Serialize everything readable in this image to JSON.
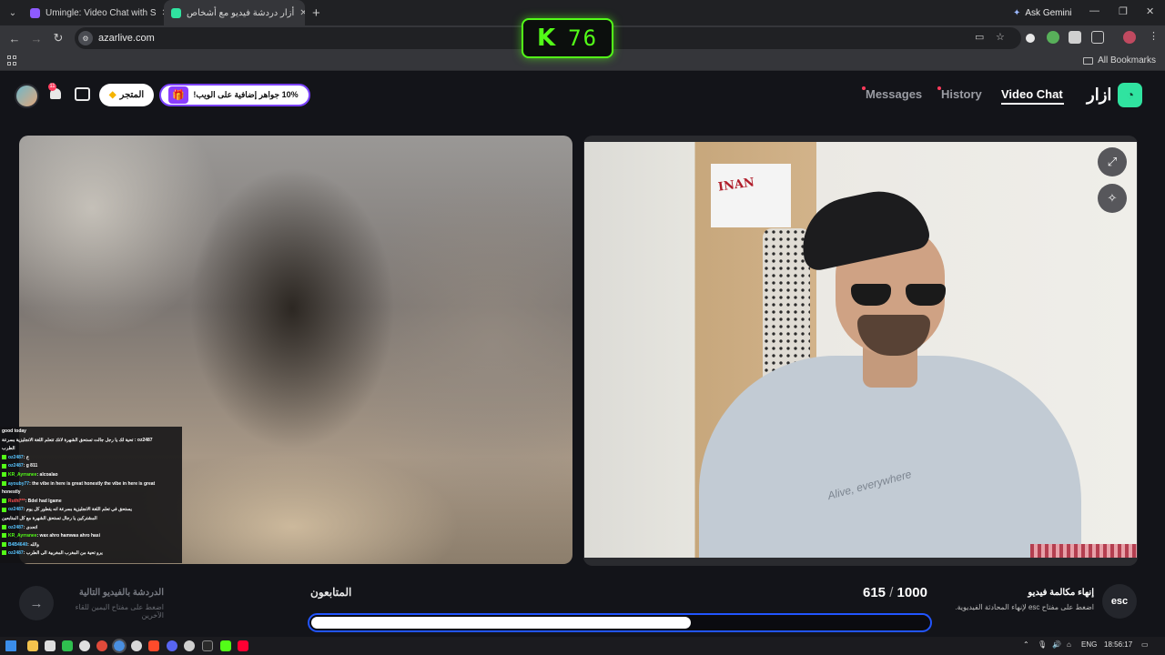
{
  "browser": {
    "tabs": [
      {
        "label": "Umingle: Video Chat with S",
        "favicon_color": "#8e5bff"
      },
      {
        "label": "أزار دردشة فيديو مع أشخاص",
        "favicon_color": "#30e3a0"
      }
    ],
    "new_tab_label": "+",
    "ask_gemini_label": "Ask Gemini",
    "url": "azarlive.com",
    "all_bookmarks_label": "All Bookmarks"
  },
  "overlay": {
    "kick_logo": "K",
    "viewer_count": "76",
    "accent": "#53fc18"
  },
  "header": {
    "store_label": "المتجر",
    "promo_label": "10% جواهر إضافية على الويب!",
    "notification_count": "11",
    "nav": {
      "messages": "Messages",
      "history": "History",
      "video_chat": "Video Chat"
    },
    "brand_word": "ازار"
  },
  "video": {
    "poster_text": "INAN",
    "shirt_text": "Alive, everywhere"
  },
  "chat": {
    "lines": [
      {
        "user": "",
        "text": "good today",
        "color": ""
      },
      {
        "user": "",
        "text": "تحية لك يا رجل جالت تستحق الشهرة لانك تتعلم اللغة الانجليزية بسرعة : oz2487",
        "color": "g"
      },
      {
        "user": "",
        "text": "الطرب",
        "color": ""
      },
      {
        "user": "oz2487",
        "text": ": خ",
        "color": "b"
      },
      {
        "user": "oz2487",
        "text": ": g 811",
        "color": "b"
      },
      {
        "user": "KR_Ayrranee",
        "text": ": alcoalao",
        "color": "g"
      },
      {
        "user": "ayouby77",
        "text": ": the vibe in here is great honestly the vibe in here is great",
        "color": "b"
      },
      {
        "user": "",
        "text": "honestly",
        "color": ""
      },
      {
        "user": "Ruthl***",
        "text": ": Bdel had lgame",
        "color": "r"
      },
      {
        "user": "oz2487",
        "text": ": يستحق في تعلم اللغة الانجليزية بسرعة انه يتطور كل يوم",
        "color": "b"
      },
      {
        "user": "",
        "text": "المشتركين يا رجال تستحق الشهرة مع كل المتابعين",
        "color": ""
      },
      {
        "user": "oz2487",
        "text": ": اتحدى",
        "color": "b"
      },
      {
        "user": "KR_Ayrranee",
        "text": ": wax ahro hamwas ahro hasi",
        "color": "g"
      },
      {
        "user": "B4B4640",
        "text": ": والله",
        "color": "b"
      },
      {
        "user": "oz2487",
        "text": ": يرو تحية من المغرب المغربية الى الطرب",
        "color": "b"
      }
    ]
  },
  "controls": {
    "next_title": "الدردشة بالفيديو التالية",
    "next_hint": "اضغط على مفتاح اليمين للقاء الآخرين",
    "followers_label": "المتابعون",
    "followers_current": "615",
    "followers_separator": "/",
    "followers_goal": "1000",
    "followers_fraction": 0.615,
    "end_title": "إنهاء مكالمة فيديو",
    "end_hint": "اضغط على مفتاح esc لإنهاء المحادثة الفيديوية.",
    "esc_label": "esc"
  },
  "taskbar": {
    "language": "ENG",
    "time": "18:56:17"
  }
}
